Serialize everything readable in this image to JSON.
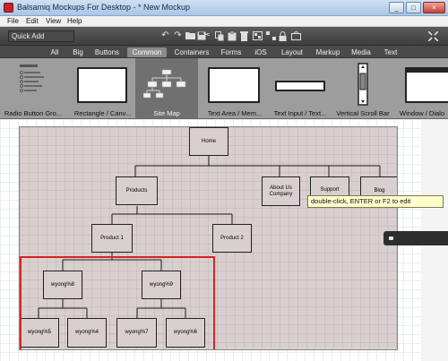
{
  "window": {
    "title": "Balsamiq Mockups For Desktop - * New Mockup",
    "controls": [
      "_",
      "□",
      "×"
    ]
  },
  "menubar": {
    "items": [
      "File",
      "Edit",
      "View",
      "Help"
    ]
  },
  "toolbar": {
    "quick_add_value": "Quick Add",
    "icons": [
      "undo-icon",
      "redo-icon",
      "open-folder-icon",
      "save-icon",
      "cut-icon",
      "copy-icon",
      "paste-icon",
      "delete-icon",
      "group-icon",
      "ungroup-icon",
      "lock-icon",
      "link-icon",
      "fullscreen-icon"
    ]
  },
  "library_tabs": {
    "items": [
      "All",
      "Big",
      "Buttons",
      "Common",
      "Containers",
      "Forms",
      "iOS",
      "Layout",
      "Markup",
      "Media",
      "Text"
    ],
    "active": "Common"
  },
  "ui_library": {
    "items": [
      "Radio Button Gro...",
      "Rectangle / Canv...",
      "Site Map",
      "Text Area / Mem...",
      "Text Input / Text...",
      "Vertical Scroll Bar",
      "Window / Dialo"
    ],
    "selected": "Site Map"
  },
  "sitemap": {
    "nodes": {
      "home": "Home",
      "products": "Products",
      "about": "About Us Company",
      "support": "Support",
      "blog": "Blog",
      "product1": "Product 1",
      "product2": "Product 2",
      "w98": "wyong%8",
      "w99": "wyong%9",
      "w95": "wyong%5",
      "w94": "wyong%4",
      "w97": "wyong%7",
      "w96": "wyong%6"
    }
  },
  "tooltip": "double-click, ENTER or F2 to edit",
  "colors": {
    "toolbar": "#4a4a4a",
    "mockup_bg": "#d9cfcf",
    "selection": "#d42424",
    "tooltip_bg": "#ffffcc"
  }
}
